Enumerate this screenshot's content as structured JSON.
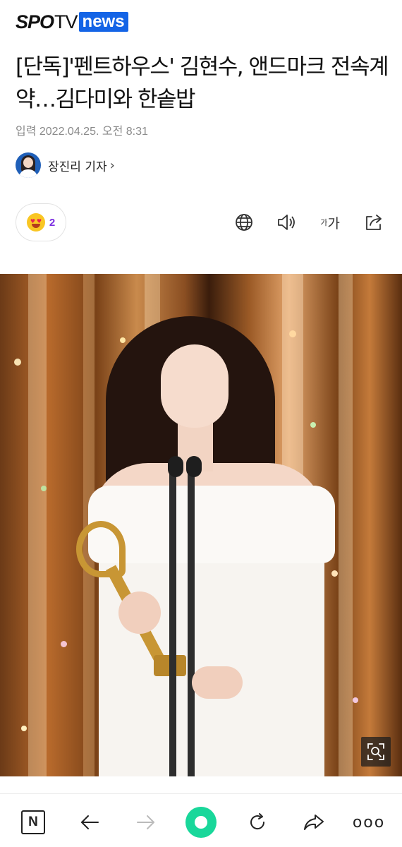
{
  "header": {
    "logo_spo": "SPO",
    "logo_tv": "TV",
    "logo_news": "news"
  },
  "article": {
    "title": "[단독]'펜트하우스' 김현수, 앤드마크 전속계약…김다미와 한솥밥",
    "date": "입력 2022.04.25. 오전 8:31",
    "reporter": "장진리 기자",
    "reporter_chevron": "›"
  },
  "reaction": {
    "icon": "heart-eyes-emoji-icon",
    "count": "2"
  },
  "toolbar": {
    "icons": [
      "globe-icon",
      "speaker-icon",
      "font-size-icon",
      "share-icon"
    ],
    "font_small": "가",
    "font_big": "가"
  },
  "photo": {
    "zoom_icon": "zoom-icon"
  },
  "bottom_nav": {
    "home_label": "N",
    "icons": [
      "naver-home-icon",
      "back-arrow-icon",
      "forward-arrow-icon",
      "green-dot-icon",
      "refresh-icon",
      "share-arrow-icon",
      "more-icon"
    ],
    "more_label": "ooo"
  },
  "colors": {
    "brand_blue": "#1464e6",
    "reaction_purple": "#7b2ee0",
    "naver_green": "#19d79a"
  }
}
